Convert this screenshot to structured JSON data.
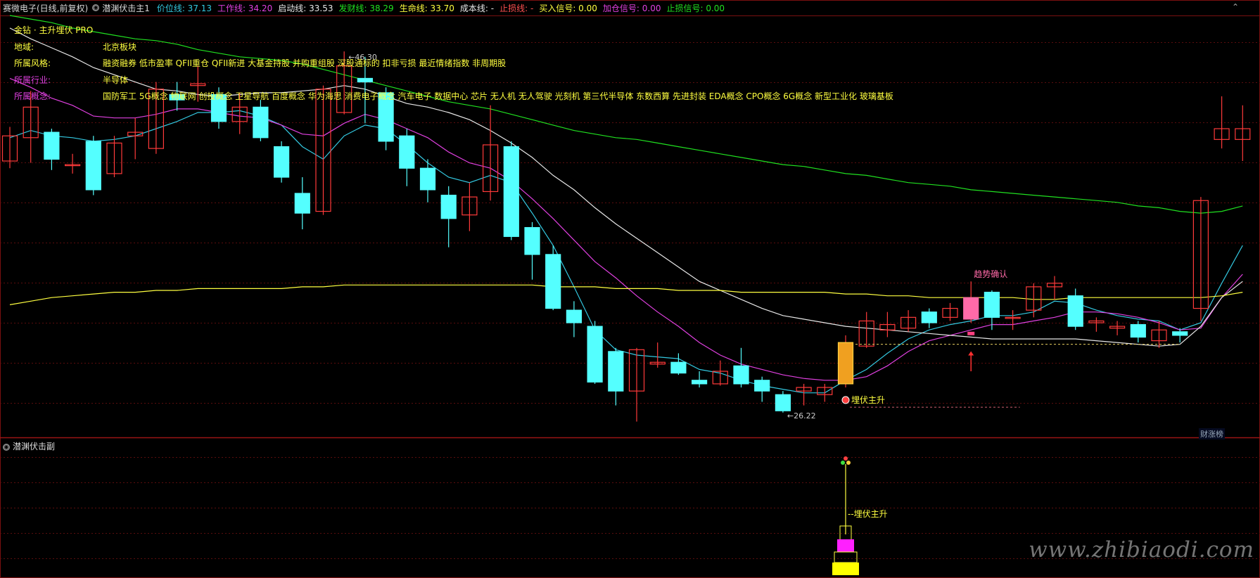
{
  "header": {
    "stock_name": "赛微电子(日线,前复权)",
    "indicator_title": "潜渊伏击主1",
    "items": [
      {
        "label": "价位线:",
        "value": "37.13",
        "color": "#33c8e0"
      },
      {
        "label": "工作线:",
        "value": "34.20",
        "color": "#e040e0"
      },
      {
        "label": "启动线:",
        "value": "33.53",
        "color": "#e8e8e8"
      },
      {
        "label": "发财线:",
        "value": "38.29",
        "color": "#20e020"
      },
      {
        "label": "生命线:",
        "value": "33.70",
        "color": "#ffff40"
      },
      {
        "label": "成本线:",
        "value": "-",
        "color": "#e8e8e8"
      },
      {
        "label": "止损线:",
        "value": "-",
        "color": "#ff5050"
      },
      {
        "label": "买入信号:",
        "value": "0.00",
        "color": "#ffff40"
      },
      {
        "label": "加仓信号:",
        "value": "0.00",
        "color": "#e040e0"
      },
      {
        "label": "止损信号:",
        "value": "0.00",
        "color": "#20e020"
      }
    ]
  },
  "info_panel": {
    "title": "金钻 · 主升埋伏 PRO",
    "rows": [
      {
        "label": "地域:",
        "value": "北京板块",
        "label_color": "#ffff40"
      },
      {
        "label": "所属风格:",
        "value": "融资融券 低市盈率 QFII重仓 QFII新进 大基金持股 并购重组股 深股通标的 扣非亏损 最近情绪指数 非周期股",
        "label_color": "#ffff40"
      },
      {
        "label": "所属行业:",
        "value": "半导体",
        "label_color": "#e040e0"
      },
      {
        "label": "所属概念:",
        "value": "国防军工 5G概念 物联网 创投概念 卫星导航 百度概念 华为海思 消费电子概念 汽车电子 数据中心 芯片 无人机 无人驾驶 光刻机 第三代半导体 东数西算 先进封装 EDA概念 CPO概念 6G概念 新型工业化 玻璃基板",
        "label_color": "#e040e0"
      }
    ]
  },
  "chart_data": {
    "type": "candlestick",
    "price_range": [
      24.9,
      48.3
    ],
    "grid": true,
    "high_label": "46.30",
    "low_label": "26.22",
    "candles": [
      {
        "o": 40.2,
        "c": 41.6,
        "h": 42.1,
        "l": 39.8
      },
      {
        "o": 41.5,
        "c": 43.2,
        "h": 44.1,
        "l": 40.1
      },
      {
        "o": 41.8,
        "c": 40.3,
        "h": 42.0,
        "l": 39.7
      },
      {
        "o": 40.0,
        "c": 40.0,
        "h": 40.6,
        "l": 39.5
      },
      {
        "o": 41.3,
        "c": 38.6,
        "h": 41.6,
        "l": 38.3
      },
      {
        "o": 39.5,
        "c": 41.2,
        "h": 41.6,
        "l": 39.3
      },
      {
        "o": 41.6,
        "c": 41.8,
        "h": 42.6,
        "l": 40.3
      },
      {
        "o": 40.9,
        "c": 44.2,
        "h": 44.6,
        "l": 40.6
      },
      {
        "o": 43.9,
        "c": 43.6,
        "h": 44.6,
        "l": 43.0
      },
      {
        "o": 44.4,
        "c": 44.5,
        "h": 45.5,
        "l": 43.5
      },
      {
        "o": 43.9,
        "c": 42.4,
        "h": 44.3,
        "l": 42.0
      },
      {
        "o": 42.4,
        "c": 43.2,
        "h": 44.0,
        "l": 41.7
      },
      {
        "o": 43.2,
        "c": 41.5,
        "h": 43.6,
        "l": 41.3
      },
      {
        "o": 41.0,
        "c": 39.3,
        "h": 41.3,
        "l": 39.0
      },
      {
        "o": 38.4,
        "c": 37.3,
        "h": 39.3,
        "l": 36.4
      },
      {
        "o": 37.4,
        "c": 44.2,
        "h": 44.4,
        "l": 37.2
      },
      {
        "o": 42.9,
        "c": 45.5,
        "h": 46.3,
        "l": 42.8
      },
      {
        "o": 44.8,
        "c": 44.6,
        "h": 46.0,
        "l": 42.3
      },
      {
        "o": 44.0,
        "c": 41.3,
        "h": 44.3,
        "l": 40.8
      },
      {
        "o": 41.6,
        "c": 39.8,
        "h": 42.0,
        "l": 38.8
      },
      {
        "o": 39.8,
        "c": 38.6,
        "h": 40.3,
        "l": 37.9
      },
      {
        "o": 38.3,
        "c": 37.0,
        "h": 38.8,
        "l": 35.4
      },
      {
        "o": 37.2,
        "c": 38.2,
        "h": 39.0,
        "l": 36.3
      },
      {
        "o": 38.5,
        "c": 41.1,
        "h": 43.3,
        "l": 38.0
      },
      {
        "o": 41.0,
        "c": 36.0,
        "h": 41.3,
        "l": 35.8
      },
      {
        "o": 36.5,
        "c": 35.0,
        "h": 36.8,
        "l": 33.6
      },
      {
        "o": 35.0,
        "c": 32.0,
        "h": 35.5,
        "l": 31.9
      },
      {
        "o": 31.9,
        "c": 31.2,
        "h": 32.4,
        "l": 30.4
      },
      {
        "o": 31.0,
        "c": 27.9,
        "h": 31.3,
        "l": 27.8
      },
      {
        "o": 29.6,
        "c": 27.4,
        "h": 29.8,
        "l": 26.6
      },
      {
        "o": 27.4,
        "c": 29.7,
        "h": 29.8,
        "l": 25.7
      },
      {
        "o": 28.9,
        "c": 29.0,
        "h": 30.1,
        "l": 28.7
      },
      {
        "o": 29.0,
        "c": 28.4,
        "h": 29.5,
        "l": 28.3
      },
      {
        "o": 28.0,
        "c": 27.8,
        "h": 28.5,
        "l": 27.6
      },
      {
        "o": 27.8,
        "c": 28.5,
        "h": 29.1,
        "l": 27.7
      },
      {
        "o": 28.8,
        "c": 27.8,
        "h": 29.8,
        "l": 27.6
      },
      {
        "o": 28.0,
        "c": 27.4,
        "h": 28.2,
        "l": 26.8
      },
      {
        "o": 27.2,
        "c": 26.3,
        "h": 27.4,
        "l": 26.2
      },
      {
        "o": 27.4,
        "c": 27.6,
        "h": 27.8,
        "l": 26.6
      },
      {
        "o": 27.2,
        "c": 27.6,
        "h": 27.8,
        "l": 26.8
      },
      {
        "o": 27.8,
        "c": 30.1,
        "h": 30.5,
        "l": 27.6
      },
      {
        "o": 29.9,
        "c": 31.3,
        "h": 31.8,
        "l": 29.8
      },
      {
        "o": 30.8,
        "c": 31.1,
        "h": 31.8,
        "l": 30.4
      },
      {
        "o": 30.9,
        "c": 31.5,
        "h": 31.9,
        "l": 30.7
      },
      {
        "o": 31.8,
        "c": 31.2,
        "h": 32.0,
        "l": 30.9
      },
      {
        "o": 31.5,
        "c": 32.0,
        "h": 32.3,
        "l": 31.3
      },
      {
        "o": 31.4,
        "c": 32.6,
        "h": 33.5,
        "l": 31.2
      },
      {
        "o": 32.9,
        "c": 31.5,
        "h": 33.0,
        "l": 30.8
      },
      {
        "o": 31.5,
        "c": 31.5,
        "h": 31.9,
        "l": 30.8
      },
      {
        "o": 31.9,
        "c": 33.2,
        "h": 33.4,
        "l": 31.5
      },
      {
        "o": 33.2,
        "c": 33.4,
        "h": 33.8,
        "l": 32.5
      },
      {
        "o": 32.7,
        "c": 31.0,
        "h": 33.1,
        "l": 30.8
      },
      {
        "o": 31.2,
        "c": 31.3,
        "h": 31.5,
        "l": 30.7
      },
      {
        "o": 30.9,
        "c": 31.0,
        "h": 31.3,
        "l": 30.5
      },
      {
        "o": 31.1,
        "c": 30.4,
        "h": 31.3,
        "l": 30.1
      },
      {
        "o": 30.2,
        "c": 30.8,
        "h": 31.3,
        "l": 29.8
      },
      {
        "o": 30.7,
        "c": 30.5,
        "h": 30.9,
        "l": 30.1
      },
      {
        "o": 32.0,
        "c": 38.0,
        "h": 38.2,
        "l": 31.3
      },
      {
        "o": 41.4,
        "c": 42.0,
        "h": 43.8,
        "l": 40.9
      },
      {
        "o": 41.4,
        "c": 42.0,
        "h": 43.3,
        "l": 40.2
      }
    ],
    "series": [
      {
        "name": "价位线",
        "color": "#33c8e0",
        "values": [
          41.5,
          41.9,
          41.6,
          41.5,
          41.3,
          41.4,
          41.6,
          42.0,
          42.4,
          42.9,
          42.9,
          43.0,
          42.7,
          42.2,
          41.0,
          40.3,
          41.6,
          42.2,
          42.0,
          41.1,
          40.1,
          39.3,
          39.0,
          39.4,
          39.0,
          37.3,
          35.5,
          33.2,
          30.8,
          29.7,
          29.4,
          29.3,
          29.2,
          28.6,
          28.4,
          28.0,
          27.7,
          27.5,
          27.3,
          27.3,
          28.0,
          28.6,
          29.5,
          30.3,
          30.8,
          31.1,
          31.3,
          31.6,
          31.6,
          31.8,
          32.4,
          32.3,
          31.9,
          31.6,
          31.4,
          31.3,
          30.8,
          31.2,
          33.4,
          35.5
        ]
      },
      {
        "name": "工作线",
        "color": "#e040e0",
        "values": [
          44.8,
          44.3,
          43.7,
          43.3,
          42.7,
          42.6,
          42.6,
          42.8,
          43.1,
          43.1,
          42.9,
          42.7,
          42.6,
          42.2,
          41.7,
          41.6,
          42.3,
          42.8,
          42.5,
          42.0,
          41.5,
          40.7,
          40.1,
          39.8,
          39.1,
          38.1,
          37.0,
          35.8,
          34.6,
          33.7,
          32.7,
          31.8,
          31.0,
          30.1,
          29.4,
          28.9,
          28.6,
          28.3,
          28.1,
          28.0,
          28.0,
          28.2,
          28.8,
          29.6,
          30.2,
          30.5,
          30.8,
          31.1,
          31.1,
          31.3,
          31.5,
          31.8,
          31.8,
          31.7,
          31.5,
          31.2,
          30.8,
          30.9,
          32.6,
          33.9
        ]
      },
      {
        "name": "启动线",
        "color": "#e8e8e8",
        "values": [
          47.6,
          47.0,
          46.5,
          46.0,
          45.4,
          45.0,
          44.6,
          44.2,
          44.1,
          43.9,
          43.8,
          43.9,
          44.0,
          44.0,
          44.1,
          44.2,
          44.4,
          44.2,
          43.8,
          43.4,
          43.2,
          42.9,
          42.5,
          41.9,
          41.2,
          40.4,
          39.4,
          38.6,
          37.6,
          36.7,
          35.9,
          35.1,
          34.3,
          33.5,
          33.0,
          32.5,
          32.0,
          31.6,
          31.4,
          31.2,
          31.0,
          30.9,
          30.8,
          30.7,
          30.6,
          30.5,
          30.4,
          30.3,
          30.3,
          30.3,
          30.3,
          30.3,
          30.2,
          30.1,
          30.0,
          29.9,
          30.0,
          31.0,
          32.6,
          33.5
        ]
      },
      {
        "name": "发财线",
        "color": "#20e020",
        "values": [
          48.3,
          48.1,
          47.9,
          47.6,
          47.4,
          47.2,
          47.0,
          46.9,
          46.7,
          46.4,
          46.2,
          46.0,
          45.9,
          45.8,
          45.6,
          45.3,
          45.0,
          44.7,
          44.4,
          44.1,
          43.8,
          43.5,
          43.3,
          43.1,
          42.8,
          42.5,
          42.2,
          41.9,
          41.7,
          41.5,
          41.4,
          41.2,
          41.0,
          40.8,
          40.6,
          40.4,
          40.2,
          40.0,
          39.9,
          39.7,
          39.5,
          39.4,
          39.2,
          39.0,
          38.9,
          38.8,
          38.6,
          38.5,
          38.4,
          38.3,
          38.2,
          38.1,
          38.0,
          37.9,
          37.7,
          37.6,
          37.4,
          37.3,
          37.4,
          37.7
        ]
      },
      {
        "name": "生命线",
        "color": "#ffff40",
        "values": [
          32.2,
          32.4,
          32.6,
          32.7,
          32.8,
          32.9,
          32.9,
          33.0,
          33.0,
          33.1,
          33.1,
          33.1,
          33.1,
          33.1,
          33.2,
          33.2,
          33.3,
          33.3,
          33.3,
          33.3,
          33.3,
          33.3,
          33.3,
          33.3,
          33.3,
          33.3,
          33.2,
          33.2,
          33.2,
          33.1,
          33.1,
          33.1,
          33.0,
          33.0,
          33.0,
          32.9,
          32.9,
          32.9,
          32.9,
          32.9,
          32.8,
          32.8,
          32.7,
          32.7,
          32.6,
          32.6,
          32.6,
          32.6,
          32.6,
          32.5,
          32.5,
          32.6,
          32.6,
          32.6,
          32.6,
          32.6,
          32.6,
          32.6,
          32.7,
          32.9
        ]
      }
    ],
    "annotations": {
      "trend_confirm": "趋势确认",
      "ambush_label": "埋伏主升"
    }
  },
  "sub_panel": {
    "title": "潜渊伏击副",
    "label": "--埋伏主升"
  },
  "badge": "财涨榜",
  "watermark": "www.zhibiaodi.com"
}
